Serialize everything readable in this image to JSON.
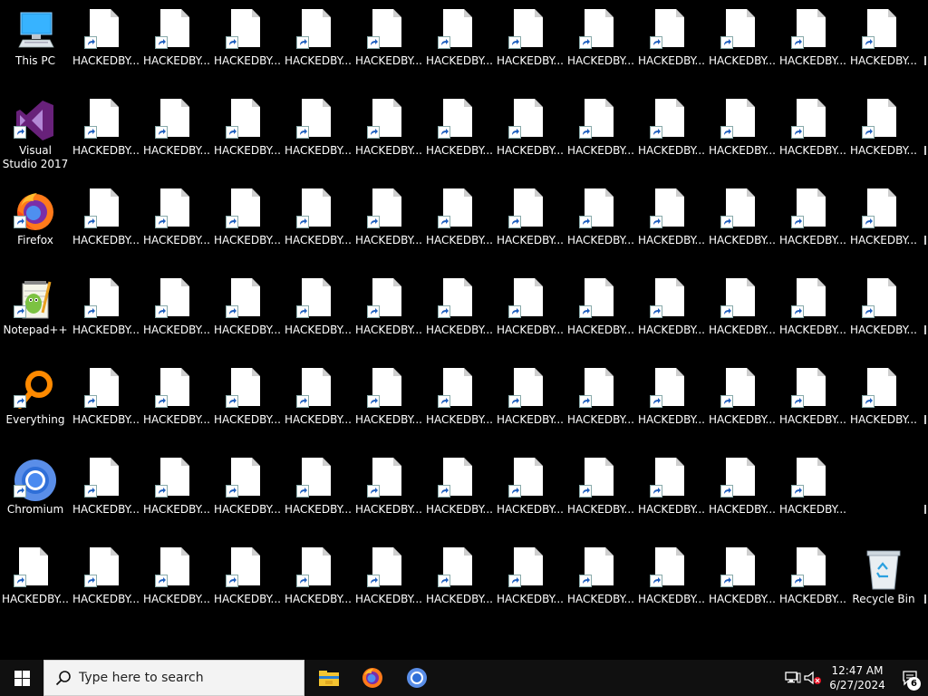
{
  "desktop": {
    "special_icons": {
      "this_pc": "This PC",
      "visual_studio": "Visual Studio 2017",
      "firefox": "Firefox",
      "notepadpp": "Notepad++",
      "everything": "Everything",
      "chromium": "Chromium",
      "recycle_bin": "Recycle Bin"
    },
    "file_label": "HACKEDBY...",
    "file_grid_counts": [
      12,
      12,
      12,
      12,
      12,
      11,
      12
    ]
  },
  "taskbar": {
    "search_placeholder": "Type here to search",
    "pinned": [
      "file-explorer-icon",
      "firefox-icon",
      "chromium-icon"
    ],
    "clock": {
      "time": "12:47 AM",
      "date": "6/27/2024"
    },
    "notification_count": "6"
  },
  "colors": {
    "desktop_bg": "#000000",
    "taskbar_bg": "#101010",
    "search_bg": "#f3f3f3",
    "shortcut_arrow": "#1e5fbf"
  }
}
